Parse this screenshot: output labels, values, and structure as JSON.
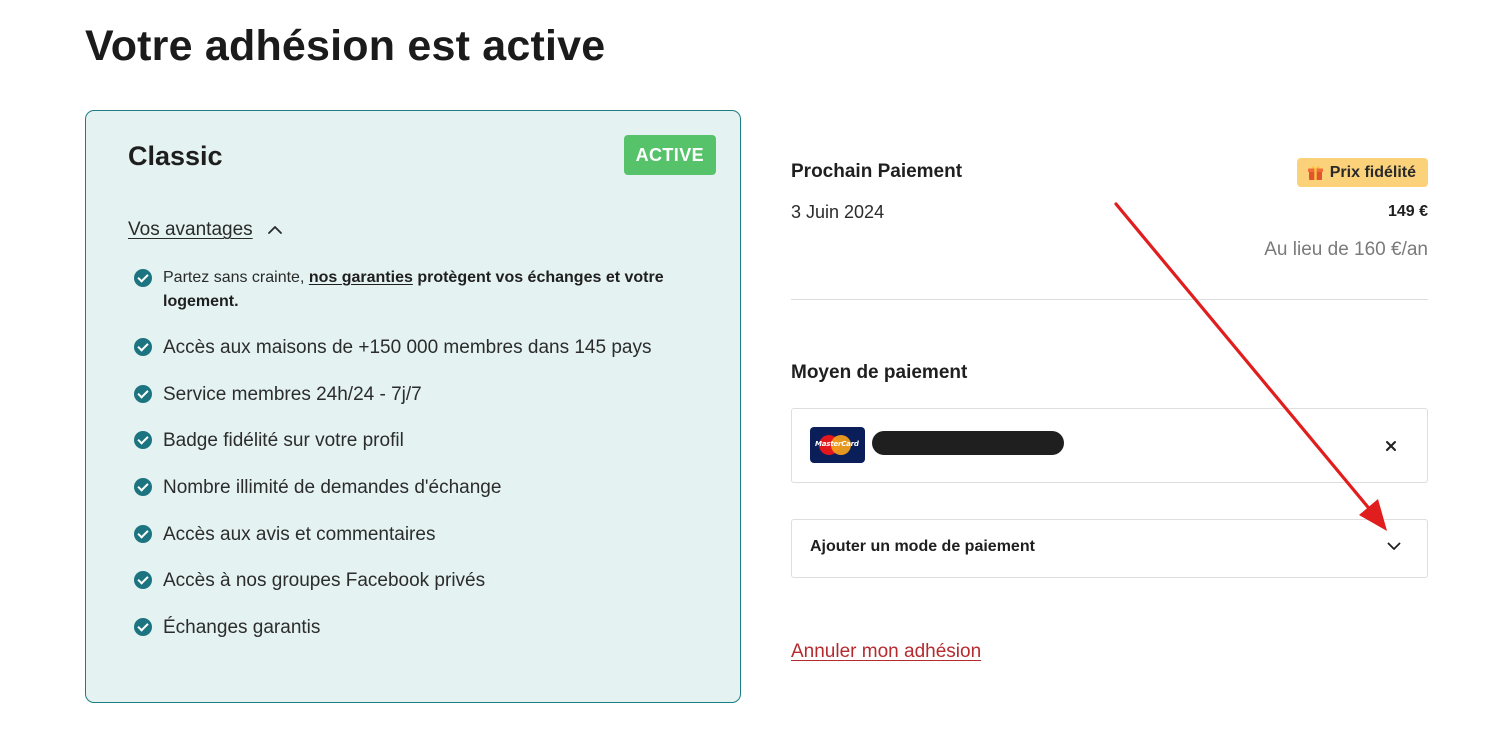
{
  "page": {
    "title": "Votre adhésion est active"
  },
  "plan": {
    "name": "Classic",
    "status": "ACTIVE",
    "benefits_toggle_label": "Vos avantages",
    "benefits_first": {
      "prefix": "Partez sans crainte, ",
      "link": "nos garanties",
      "suffix": " protègent vos échanges et votre logement."
    },
    "benefits": [
      "Accès aux maisons de +150 000 membres dans 145 pays",
      "Service membres 24h/24 - 7j/7",
      "Badge fidélité sur votre profil",
      "Nombre illimité de demandes d'échange",
      "Accès aux avis et commentaires",
      "Accès à nos groupes Facebook privés",
      "Échanges garantis"
    ]
  },
  "payment": {
    "next_title": "Prochain Paiement",
    "loyalty_badge": "Prix fidélité",
    "date": "3 Juin 2024",
    "price": "149 €",
    "old_price": "Au lieu de 160 €/an",
    "method_title": "Moyen de paiement",
    "card_brand": "MasterCard",
    "add_method_label": "Ajouter un mode de paiement",
    "cancel_label": "Annuler mon adhésion"
  },
  "icons": {
    "check": "check-circle-icon",
    "toggle": "chevron-up-icon",
    "gift": "gift-icon",
    "card": "mastercard-icon",
    "remove": "close-icon",
    "expand": "chevron-down-icon"
  },
  "colors": {
    "card_bg": "#e4f2f2",
    "card_border": "#1c7d82",
    "check": "#1c7480",
    "active_badge": "#56c36b",
    "loyalty_badge": "#fbd27a",
    "cancel_link": "#b52a2f",
    "annotation_arrow": "#e01e1e"
  }
}
